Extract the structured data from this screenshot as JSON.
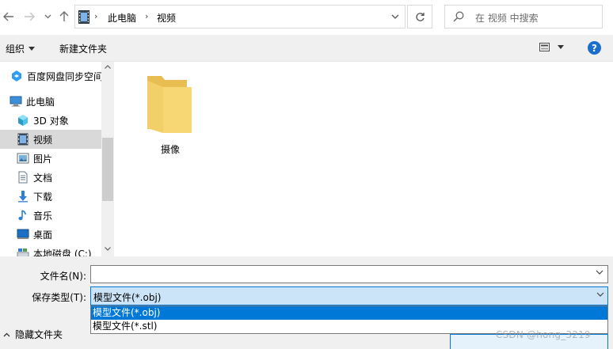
{
  "address": {
    "crumbs": [
      "此电脑",
      "视频"
    ],
    "search_placeholder": "在 视频 中搜索"
  },
  "toolbar": {
    "organize_label": "组织",
    "new_folder_label": "新建文件夹"
  },
  "sidebar": {
    "items": [
      {
        "label": "百度网盘同步空间",
        "icon": "baidu-netdisk-icon"
      },
      {
        "label": "此电脑",
        "icon": "computer-icon"
      },
      {
        "label": "3D 对象",
        "icon": "3d-objects-icon"
      },
      {
        "label": "视频",
        "icon": "video-icon",
        "selected": true
      },
      {
        "label": "图片",
        "icon": "pictures-icon"
      },
      {
        "label": "文档",
        "icon": "documents-icon"
      },
      {
        "label": "下载",
        "icon": "downloads-icon"
      },
      {
        "label": "音乐",
        "icon": "music-icon"
      },
      {
        "label": "桌面",
        "icon": "desktop-icon"
      },
      {
        "label": "本地磁盘 (C:)",
        "icon": "local-disk-icon"
      }
    ]
  },
  "content": {
    "items": [
      {
        "label": "摄像",
        "icon": "folder-icon"
      }
    ]
  },
  "bottom": {
    "filename_label": "文件名(N):",
    "filename_value": "",
    "savetype_label": "保存类型(T):",
    "savetype_value": "模型文件(*.obj)",
    "savetype_options": [
      "模型文件(*.obj)",
      "模型文件(*.stl)"
    ],
    "hide_folders_label": "隐藏文件夹"
  },
  "watermark": "CSDN @hong_3219",
  "colors": {
    "accent": "#0078d7",
    "selection_bg": "#cce4f7",
    "folder": "#f7d674",
    "help": "#1a6ecf"
  }
}
